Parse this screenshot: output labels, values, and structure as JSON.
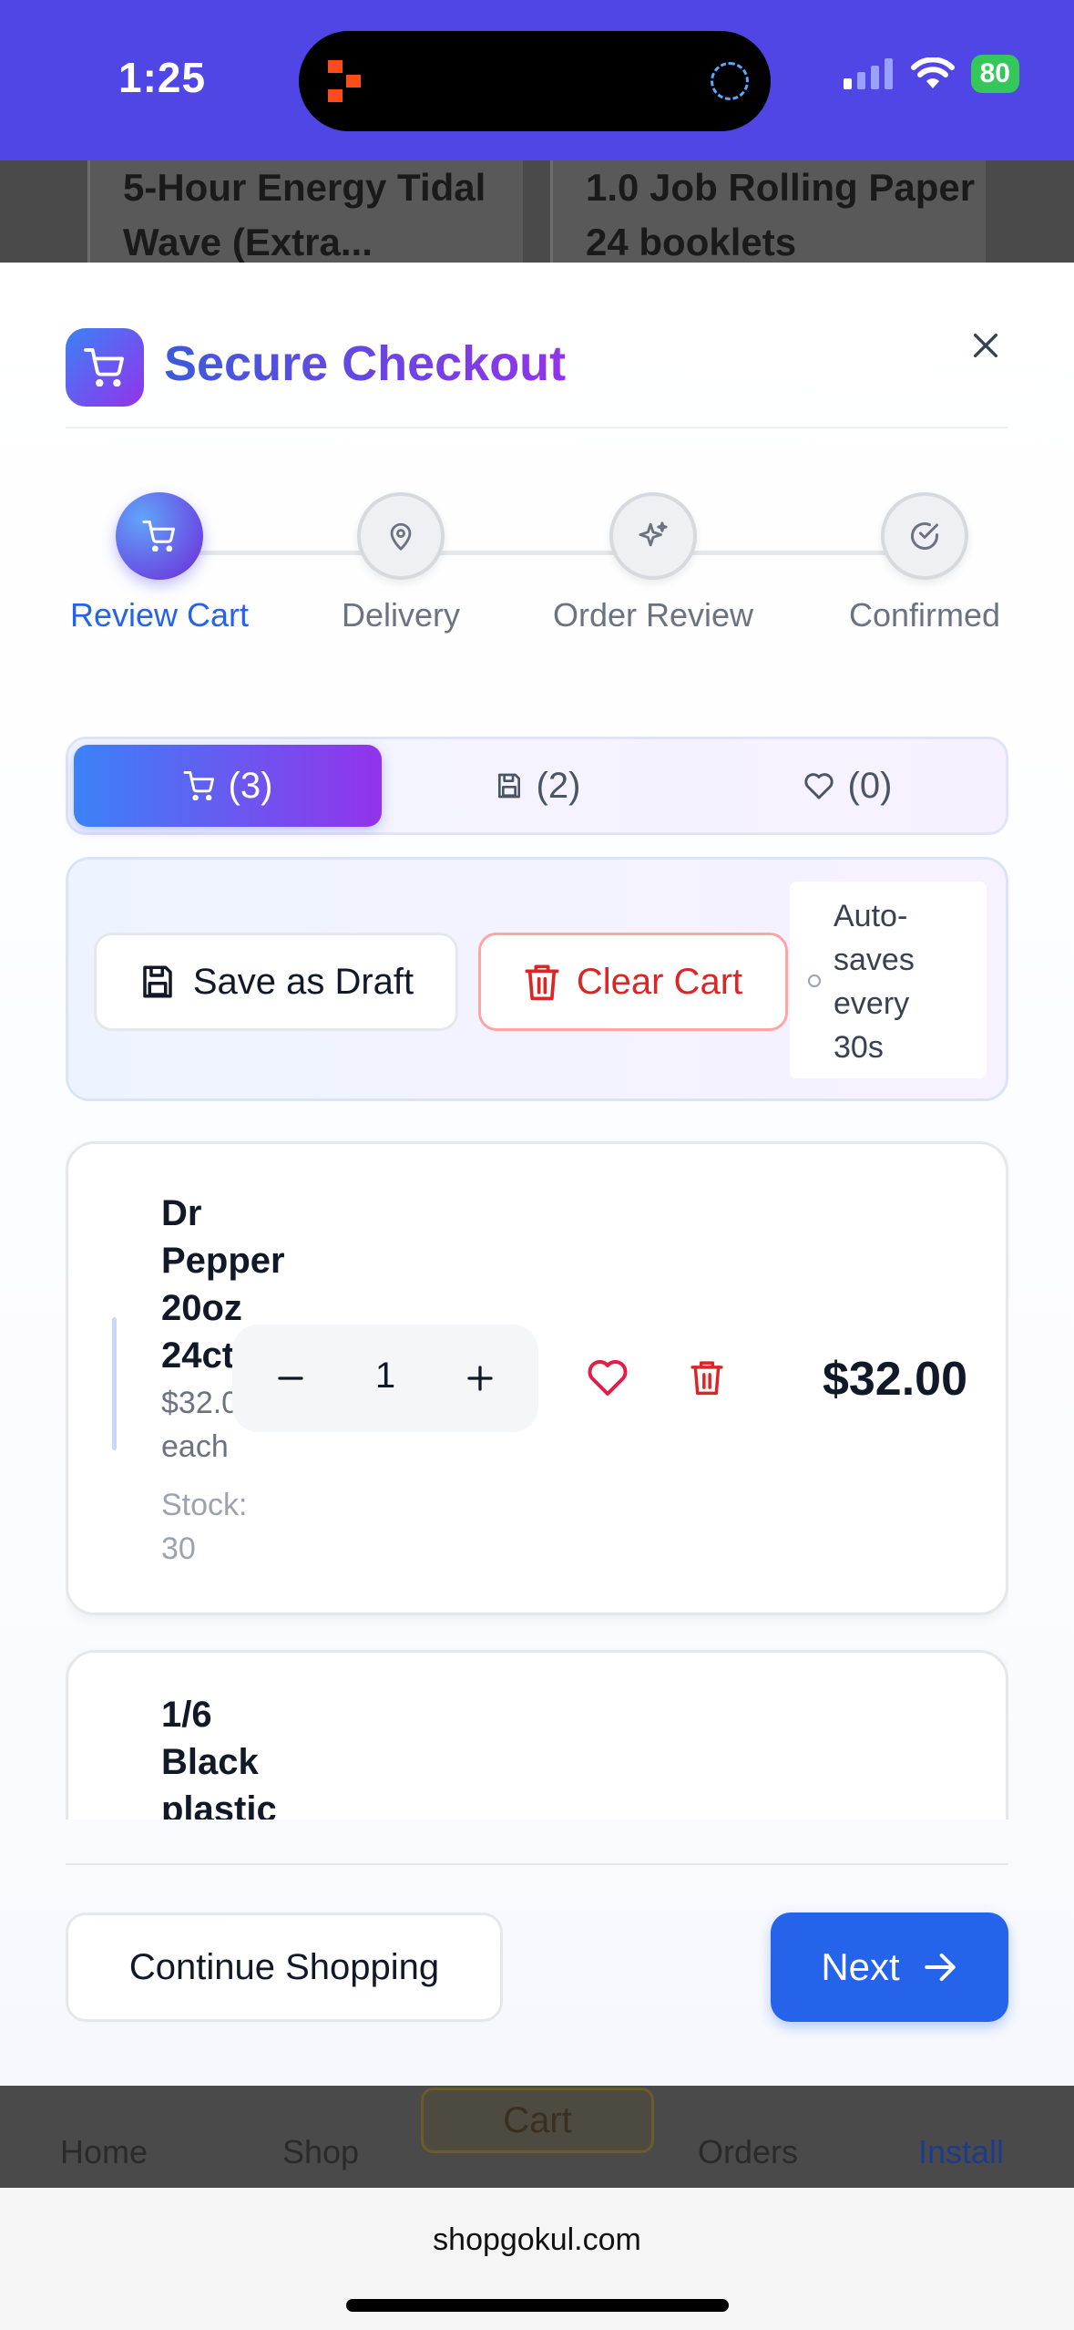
{
  "status_bar": {
    "time": "1:25",
    "battery": "80"
  },
  "background_page": {
    "products": [
      "5-Hour Energy Tidal Wave (Extra...",
      "1.0 Job Rolling Paper 24 booklets"
    ],
    "nav": [
      "Home",
      "Shop",
      "Cart",
      "Orders",
      "Install"
    ]
  },
  "modal": {
    "title": "Secure Checkout",
    "steps": [
      {
        "label": "Review Cart",
        "icon": "cart-icon",
        "active": true
      },
      {
        "label": "Delivery",
        "icon": "map-pin-icon",
        "active": false
      },
      {
        "label": "Order Review",
        "icon": "sparkles-icon",
        "active": false
      },
      {
        "label": "Confirmed",
        "icon": "check-circle-icon",
        "active": false
      }
    ],
    "tabs": [
      {
        "label": "(3)",
        "icon": "cart-icon",
        "active": true
      },
      {
        "label": "(2)",
        "icon": "save-icon",
        "active": false
      },
      {
        "label": "(0)",
        "icon": "heart-icon",
        "active": false
      }
    ],
    "actions": {
      "save_draft": "Save as Draft",
      "clear_cart": "Clear Cart",
      "autosave_lines": [
        "Auto-",
        "saves",
        "every",
        "30s"
      ]
    },
    "items": [
      {
        "name_lines": [
          "Dr",
          "Pepper",
          "20oz",
          "24ct"
        ],
        "each_lines": [
          "$32.00",
          "each"
        ],
        "stock_lines": [
          "Stock:",
          "30"
        ],
        "quantity": "1",
        "total": "$32.00"
      },
      {
        "name_lines": [
          "1/6",
          "Black",
          "plastic"
        ]
      }
    ],
    "footer": {
      "continue": "Continue Shopping",
      "next": "Next"
    }
  },
  "browser": {
    "url": "shopgokul.com"
  },
  "colors": {
    "status_bar": "#4f46e5",
    "primary": "#2563eb",
    "accent_purple": "#9333ea",
    "danger": "#dc2626"
  }
}
